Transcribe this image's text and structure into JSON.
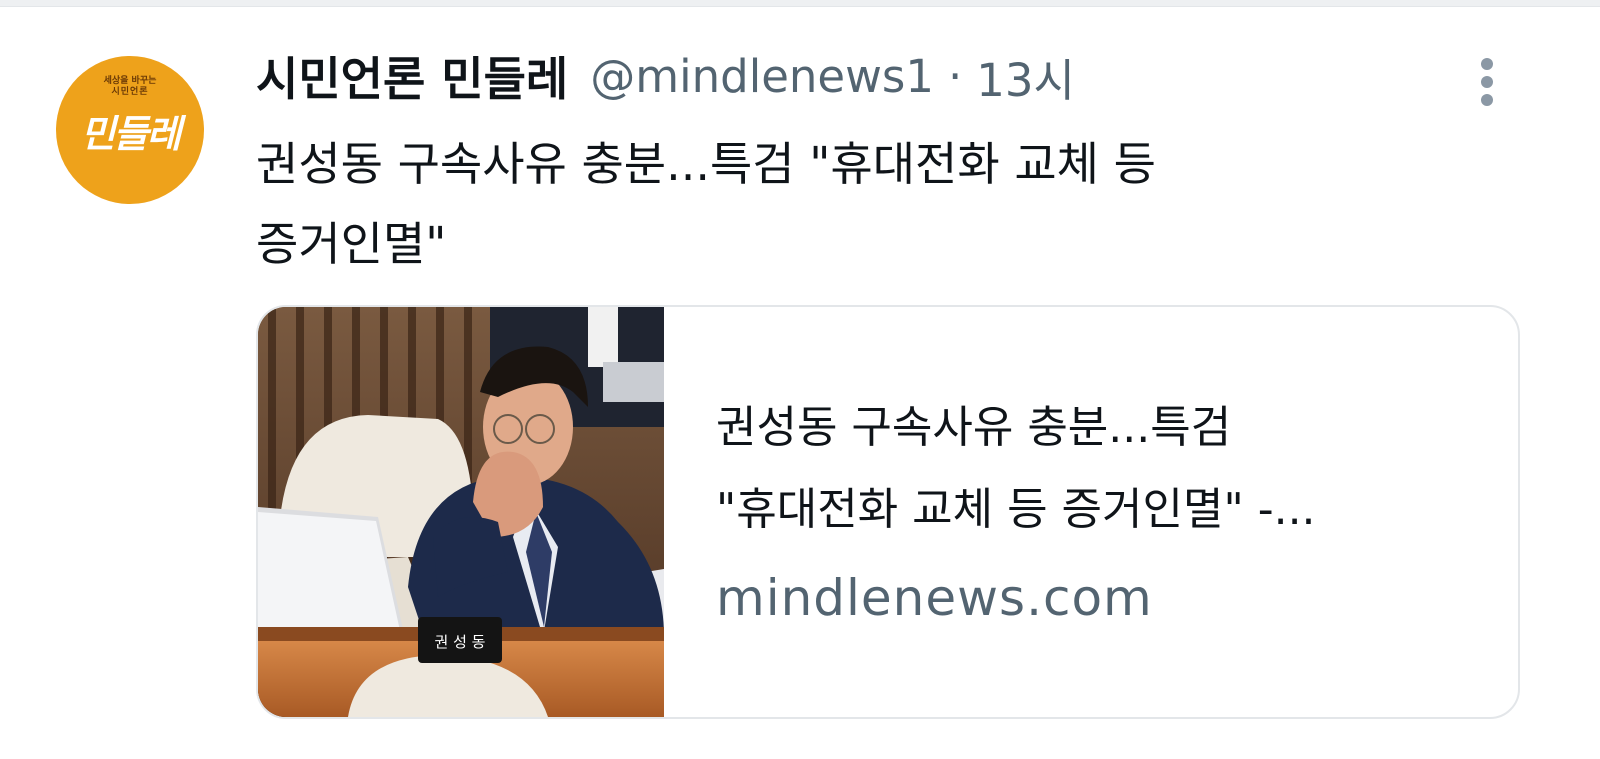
{
  "account": {
    "display_name": "시민언론 민들레",
    "handle": "@mindlenews1",
    "separator": "·",
    "time": "13시"
  },
  "avatar": {
    "slogan": "세상을 바꾸는",
    "name": "시민언론",
    "logo": "민들레"
  },
  "tweet": {
    "text_line1": "권성동 구속사유 충분...특검 \"휴대전화 교체 등",
    "text_line2": "증거인멸\""
  },
  "card": {
    "title_line1": "권성동 구속사유 충분...특검",
    "title_line2": "\"휴대전화 교체 등 증거인멸\" -...",
    "domain": "mindlenews.com",
    "nameplate": "권 성 동"
  },
  "icons": {
    "more": "more-vertical-icon"
  }
}
